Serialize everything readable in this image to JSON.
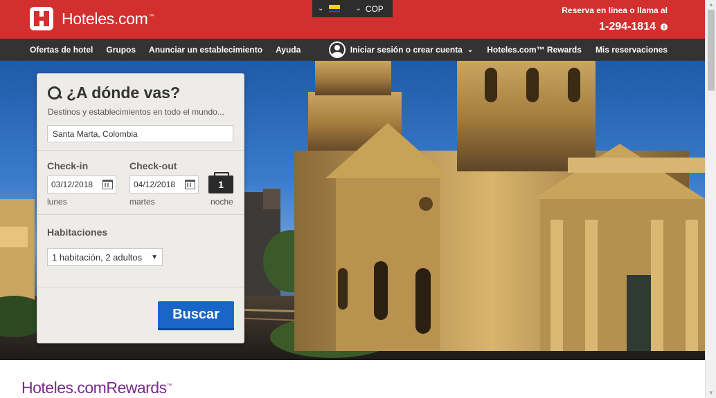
{
  "header": {
    "logo_text": "Hoteles.com",
    "logo_tm": "™",
    "currency": "COP",
    "reserve_text": "Reserva en línea o llama al",
    "phone": "1-294-1814",
    "colors": {
      "brand_red": "#d32f2f",
      "nav_bg": "#333333",
      "locale_bg": "#2d2d2d"
    }
  },
  "nav": {
    "left": [
      "Ofertas de hotel",
      "Grupos",
      "Anunciar un establecimiento",
      "Ayuda"
    ],
    "account": "Iniciar sesión o crear cuenta",
    "rewards": "Hoteles.com™ Rewards",
    "reservations": "Mis reservaciones"
  },
  "search": {
    "title": "¿A dónde vas?",
    "subtitle": "Destinos y establecimientos en todo el mundo...",
    "destination_value": "Santa Marta, Colombia",
    "checkin_label": "Check-in",
    "checkout_label": "Check-out",
    "checkin_value": "03/12/2018",
    "checkout_value": "04/12/2018",
    "checkin_day": "lunes",
    "checkout_day": "martes",
    "nights_count": "1",
    "nights_label": "noche",
    "rooms_label": "Habitaciones",
    "rooms_value": "1 habitación, 2 adultos",
    "button_label": "Buscar",
    "button_color": "#1a66c8"
  },
  "rewards_banner": {
    "brand": "Hoteles.com",
    "word": "Rewards",
    "tm": "™",
    "color": "#7a2b8c"
  },
  "icons": {
    "logo": "hoteles-h-logo-icon",
    "locale_chevron": "chevron-down-icon",
    "flag": "colombia-flag-icon",
    "info": "info-icon",
    "account": "user-avatar-icon",
    "search": "search-icon",
    "calendar": "calendar-icon",
    "nights": "suitcase-icon",
    "caret": "caret-down-icon"
  }
}
